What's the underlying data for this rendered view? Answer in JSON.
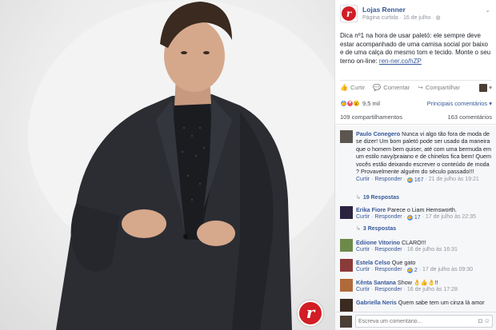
{
  "post": {
    "page_name": "Lojas Renner",
    "meta": "Página curtida · 16 de julho · ",
    "text": "Dica nº1 na hora de usar paletó: ele sempre deve estar acompanhado de uma camisa social por baixo e de uma calça do mesmo tom e tecido. Monte o seu terno on-line: ",
    "link": "ren-ner.co/hZP",
    "logo_letter": "r"
  },
  "actions": {
    "like": "Curtir",
    "comment": "Comentar",
    "share": "Compartilhar"
  },
  "reactions": {
    "count": "9,5 mil",
    "sort_label": "Principais comentários ▾"
  },
  "counts": {
    "shares": "109 compartilhamentos",
    "comments": "163 comentários"
  },
  "comments": [
    {
      "author": "Paulo Conegero",
      "text": " Nunca vi algo tão fora de moda de se dizer! Um bom paletó pode ser usado da maneira que o homem bem quiser, até com uma bermuda em um estilo navy/praiano e de chinelos fica bem! Quem vocês estão deixando escrever o conteúdo de moda ? Provavelmente alguém do século passado!!!",
      "like": "Curtir",
      "reply": "Responder",
      "likes": "167",
      "time": "21 de julho às 19:21",
      "replies": "19 Respostas"
    },
    {
      "author": "Erika Fiore",
      "text": " Parece o Liam Hemsworth.",
      "like": "Curtir",
      "reply": "Responder",
      "likes": "17",
      "time": "17 de julho às 22:35",
      "replies": "3 Respostas"
    },
    {
      "author": "Ediione Vitorino",
      "text": " CLARO!!!",
      "like": "Curtir",
      "reply": "Responder",
      "likes": "",
      "time": "16 de julho às 16:31"
    },
    {
      "author": "Estela Celso",
      "text": " Que gato",
      "like": "Curtir",
      "reply": "Responder",
      "likes": "2",
      "time": "17 de julho às 09:30"
    },
    {
      "author": "Kênta Santana",
      "text": " Show 👌👍👌!!",
      "like": "Curtir",
      "reply": "Responder",
      "likes": "",
      "time": "16 de julho às 17:28"
    },
    {
      "author": "Gabriella Neris",
      "text": " Quem sabe tem um cinza lá amor"
    }
  ],
  "composer": {
    "placeholder": "Escreva um comentário..."
  },
  "colors": {
    "brand_red": "#d21d25",
    "link_blue": "#365899",
    "muted": "#90949c"
  },
  "icons": [
    "globe-icon",
    "chevron-down-icon",
    "like-icon",
    "comment-icon",
    "share-icon",
    "camera-icon",
    "smiley-icon"
  ]
}
